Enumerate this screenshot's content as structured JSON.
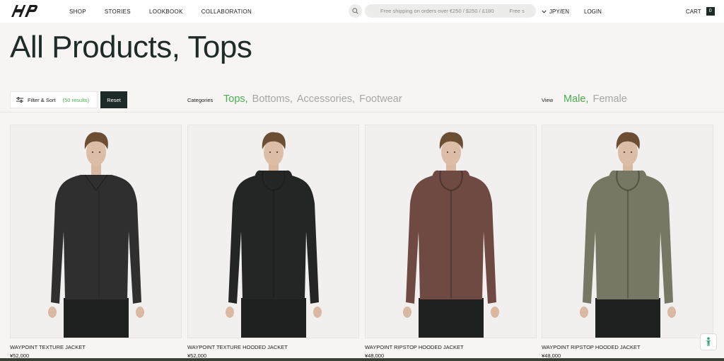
{
  "nav": {
    "links": [
      "SHOP",
      "STORIES",
      "LOOKBOOK",
      "COLLABORATION"
    ],
    "ticker": "Free shipping on orders over €250 / $250 / £180",
    "ticker_repeat": "Free s",
    "lang": "JPY/EN",
    "login": "LOGIN",
    "cart": "CART",
    "cart_count": "0"
  },
  "page": {
    "title": "All Products, Tops"
  },
  "toolbar": {
    "filter_label": "Filter & Sort",
    "results": "(50 results)",
    "reset_label": "Reset",
    "categories_label": "Categories",
    "categories": [
      "Tops,",
      "Bottoms,",
      "Accessories,",
      "Footwear"
    ],
    "view_label": "View",
    "genders": [
      "Male,",
      "Female"
    ]
  },
  "products": [
    {
      "name": "WAYPOINT TEXTURE JACKET",
      "price": "¥52,000",
      "color": "#2e2f2e",
      "hood": false
    },
    {
      "name": "WAYPOINT TEXTURE HOODED JACKET",
      "price": "¥52,000",
      "color": "#242525",
      "hood": true
    },
    {
      "name": "WAYPOINT RIPSTOP HOODED JACKET",
      "price": "¥48,000",
      "color": "#6e4a42",
      "hood": true
    },
    {
      "name": "WAYPOINT RIPSTOP HOODED JACKET",
      "price": "¥48,000",
      "color": "#777863",
      "hood": true
    }
  ],
  "colors": {
    "accent_green": "#4caf50",
    "dark_button": "#1c2b27"
  }
}
